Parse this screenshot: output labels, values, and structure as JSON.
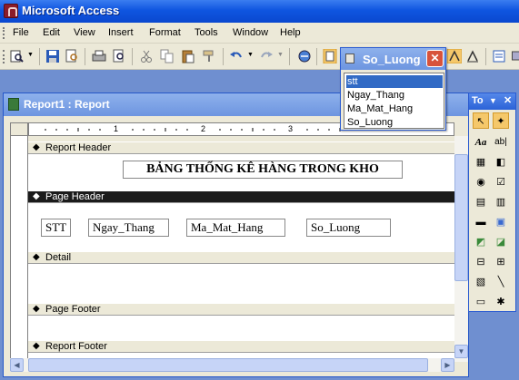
{
  "app": {
    "title": "Microsoft Access"
  },
  "menu": {
    "items": [
      "File",
      "Edit",
      "View",
      "Insert",
      "Format",
      "Tools",
      "Window",
      "Help"
    ]
  },
  "toolbar": {
    "buttons": [
      "view-icon",
      "save-icon",
      "print-preview-icon",
      "print-icon",
      "cut-icon",
      "copy-icon",
      "paste-icon",
      "format-painter-icon",
      "undo-icon",
      "redo-icon",
      "hyperlink-icon",
      "field-list-icon",
      "toolbox-icon",
      "properties-icon"
    ]
  },
  "report_window": {
    "title": "Report1 : Report",
    "ruler_numbers": [
      "1",
      "2",
      "3"
    ],
    "sections": {
      "report_header": "Report Header",
      "page_header": "Page Header",
      "detail": "Detail",
      "page_footer": "Page Footer",
      "report_footer": "Report Footer"
    },
    "report_title": "BẢNG THỐNG KÊ HÀNG TRONG KHO",
    "column_labels": [
      "STT",
      "Ngay_Thang",
      "Ma_Mat_Hang",
      "So_Luong"
    ]
  },
  "field_list": {
    "title": "So_Luong",
    "close": "✕",
    "fields": [
      "stt",
      "Ngay_Thang",
      "Ma_Mat_Hang",
      "So_Luong"
    ],
    "selected_index": 0
  },
  "toolbox": {
    "title": "To",
    "tools": [
      "select-objects-icon",
      "control-wizards-icon",
      "label-icon",
      "textbox-icon",
      "option-group-icon",
      "toggle-button-icon",
      "option-button-icon",
      "checkbox-icon",
      "combo-box-icon",
      "list-box-icon",
      "command-button-icon",
      "image-icon",
      "unbound-object-icon",
      "bound-object-icon",
      "page-break-icon",
      "tab-control-icon",
      "subform-icon",
      "line-icon",
      "rectangle-icon",
      "more-controls-icon"
    ]
  }
}
